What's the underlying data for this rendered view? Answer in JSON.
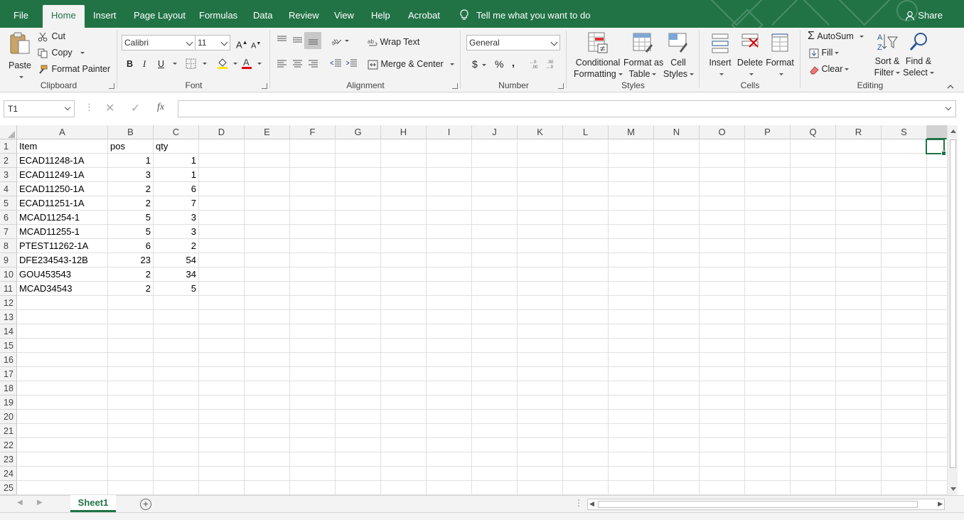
{
  "ribbon_tabs": [
    "File",
    "Home",
    "Insert",
    "Page Layout",
    "Formulas",
    "Data",
    "Review",
    "View",
    "Help",
    "Acrobat"
  ],
  "active_tab": "Home",
  "tell_me": "Tell me what you want to do",
  "share_label": "Share",
  "clipboard": {
    "label": "Clipboard",
    "paste": "Paste",
    "cut": "Cut",
    "copy": "Copy",
    "format_painter": "Format Painter"
  },
  "font": {
    "label": "Font",
    "name": "Calibri",
    "size": "11",
    "bold": "B",
    "italic": "I",
    "underline": "U"
  },
  "alignment": {
    "label": "Alignment",
    "wrap_text": "Wrap Text",
    "merge_center": "Merge & Center"
  },
  "number": {
    "label": "Number",
    "format": "General",
    "currency": "$",
    "percent": "%",
    "comma": ","
  },
  "styles": {
    "label": "Styles",
    "conditional_1": "Conditional",
    "conditional_2": "Formatting",
    "format_table_1": "Format as",
    "format_table_2": "Table",
    "cell_styles_1": "Cell",
    "cell_styles_2": "Styles"
  },
  "cells": {
    "label": "Cells",
    "insert": "Insert",
    "delete": "Delete",
    "format": "Format"
  },
  "editing": {
    "label": "Editing",
    "autosum": "AutoSum",
    "fill": "Fill",
    "clear": "Clear",
    "sort_1": "Sort &",
    "sort_2": "Filter",
    "find_1": "Find &",
    "find_2": "Select"
  },
  "name_box": "T1",
  "formula_value": "",
  "columns": [
    "A",
    "B",
    "C",
    "D",
    "E",
    "F",
    "G",
    "H",
    "I",
    "J",
    "K",
    "L",
    "M",
    "N",
    "O",
    "P",
    "Q",
    "R",
    "S"
  ],
  "row_numbers": [
    "1",
    "2",
    "3",
    "4",
    "5",
    "6",
    "7",
    "8",
    "9",
    "10",
    "11",
    "12",
    "13",
    "14",
    "15",
    "16",
    "17",
    "18",
    "19",
    "20",
    "21",
    "22",
    "23",
    "24",
    "25"
  ],
  "grid": [
    [
      "Item",
      "pos",
      "qty"
    ],
    [
      "ECAD11248-1A",
      "1",
      "1"
    ],
    [
      "ECAD11249-1A",
      "3",
      "1"
    ],
    [
      "ECAD11250-1A",
      "2",
      "6"
    ],
    [
      "ECAD11251-1A",
      "2",
      "7"
    ],
    [
      "MCAD11254-1",
      "5",
      "3"
    ],
    [
      "MCAD11255-1",
      "5",
      "3"
    ],
    [
      "PTEST11262-1A",
      "6",
      "2"
    ],
    [
      "DFE234543-12B",
      "23",
      "54"
    ],
    [
      "GOU453543",
      "2",
      "34"
    ],
    [
      "MCAD34543",
      "2",
      "5"
    ]
  ],
  "sheet_tab": "Sheet1",
  "colors": {
    "accent": "#217346",
    "ribbon_bg": "#f3f3f3",
    "font_color_red": "#e00000",
    "highlight_yellow": "#ffe600"
  }
}
